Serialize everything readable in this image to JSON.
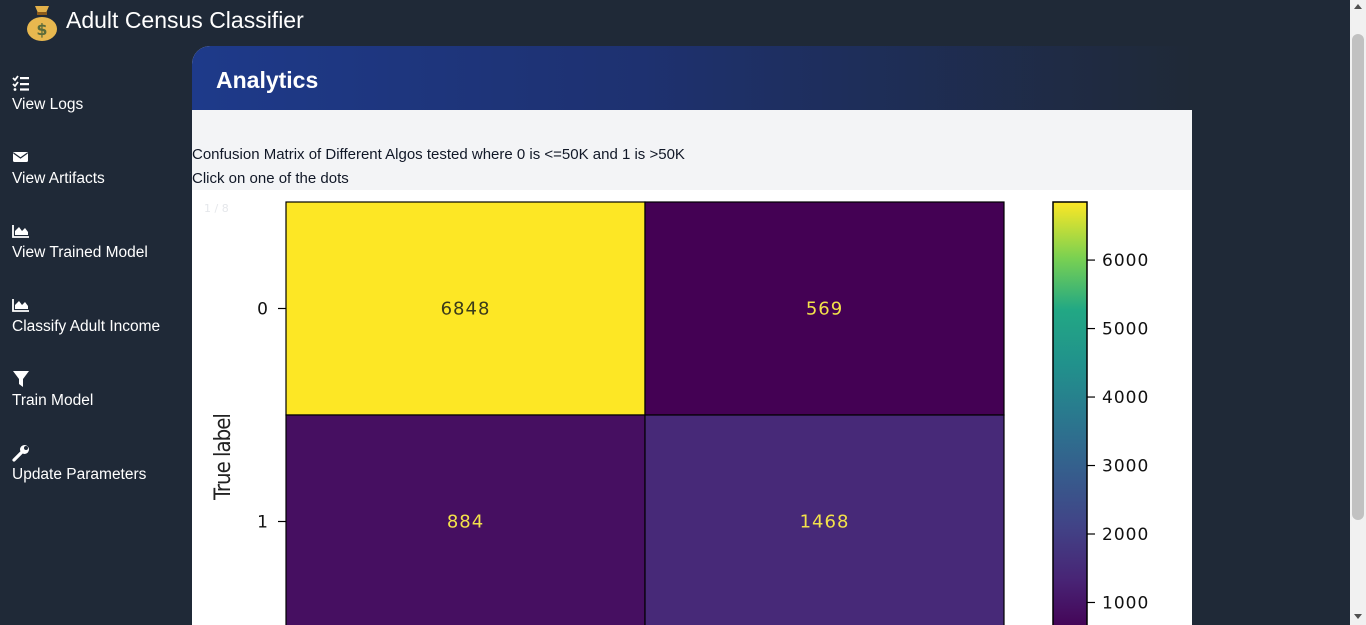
{
  "app": {
    "title": "Adult Census Classifier",
    "logo_icon": "money-bag-icon"
  },
  "sidebar": {
    "items": [
      {
        "label": "View Logs",
        "icon": "list-check-icon"
      },
      {
        "label": "View Artifacts",
        "icon": "envelope-icon"
      },
      {
        "label": "View Trained Model",
        "icon": "area-chart-icon"
      },
      {
        "label": "Classify Adult Income",
        "icon": "area-chart-icon"
      },
      {
        "label": "Train Model",
        "icon": "filter-icon"
      },
      {
        "label": "Update Parameters",
        "icon": "wrench-icon"
      }
    ]
  },
  "main": {
    "title": "Analytics",
    "description": "Confusion Matrix of Different Algos tested where 0 is <=50K and 1 is >50K",
    "instruction": "Click on one of the dots",
    "slide_counter": "1 / 8"
  },
  "colors": {
    "background": "#1f2937",
    "header_accent": "#1e3a8a",
    "panel": "#f3f4f6"
  },
  "chart_data": {
    "type": "heatmap",
    "ylabel": "True label",
    "row_labels": [
      "0",
      "1"
    ],
    "matrix": [
      [
        6848,
        569
      ],
      [
        884,
        1468
      ]
    ],
    "colorbar_ticks": [
      6000,
      5000,
      4000,
      3000,
      2000,
      1000
    ],
    "colorbar_range": [
      569,
      6848
    ],
    "colormap": "viridis"
  }
}
